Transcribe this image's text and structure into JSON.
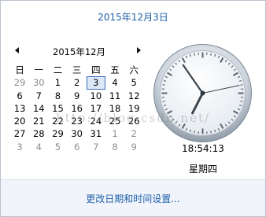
{
  "header": {
    "long_date": "2015年12月3日"
  },
  "calendar": {
    "month_title": "2015年12月",
    "weekdays": [
      "日",
      "一",
      "二",
      "三",
      "四",
      "五",
      "六"
    ],
    "rows": [
      [
        "29",
        "30",
        "1",
        "2",
        "3",
        "4",
        "5"
      ],
      [
        "6",
        "7",
        "8",
        "9",
        "10",
        "11",
        "12"
      ],
      [
        "13",
        "14",
        "15",
        "16",
        "17",
        "18",
        "19"
      ],
      [
        "20",
        "21",
        "22",
        "23",
        "24",
        "25",
        "26"
      ],
      [
        "27",
        "28",
        "29",
        "30",
        "31",
        "1",
        "2"
      ],
      [
        "3",
        "4",
        "5",
        "6",
        "7",
        "8",
        "9"
      ]
    ],
    "today": "3"
  },
  "clock": {
    "time": "18:54:13",
    "weekday": "星期四"
  },
  "footer": {
    "link_label": "更改日期和时间设置..."
  },
  "watermark": "http://blog.csdn.net/",
  "colors": {
    "link": "#1e5fa8",
    "today_border": "#3b6fb6",
    "footer_bg": "#f1f5fb"
  },
  "icons": {
    "prev": "triangle-left",
    "next": "triangle-right"
  }
}
